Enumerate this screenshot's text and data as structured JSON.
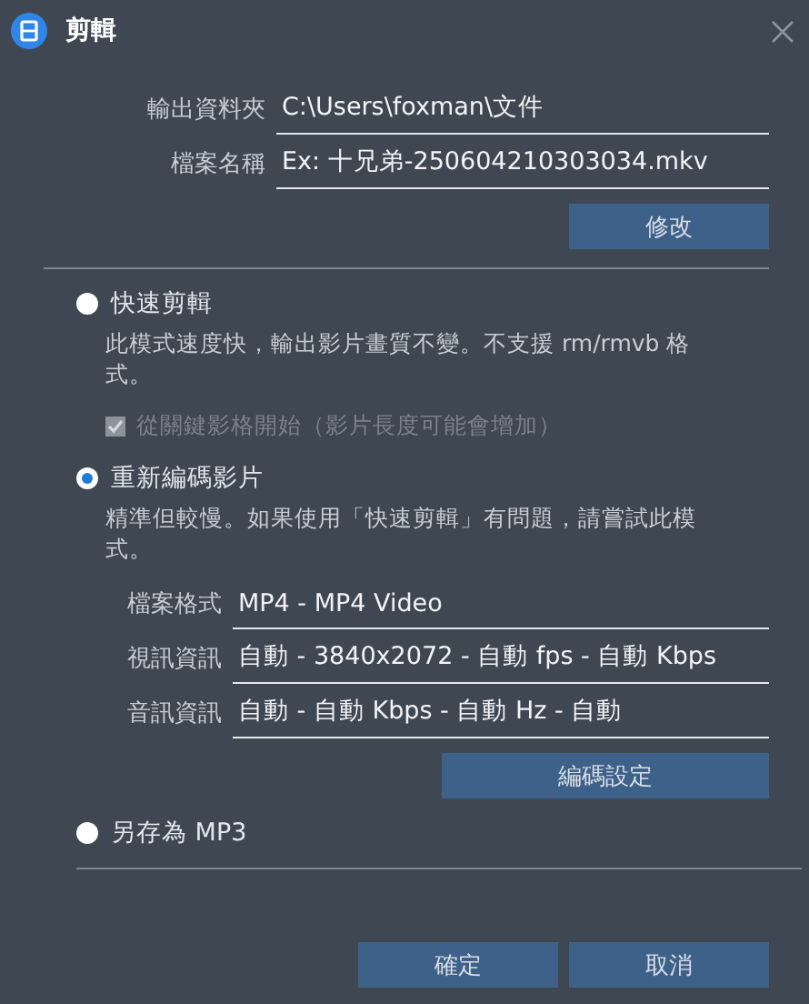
{
  "window": {
    "title": "剪輯"
  },
  "output": {
    "fields": [
      {
        "label": "輸出資料夾",
        "value": "C:\\Users\\foxman\\文件"
      },
      {
        "label": "檔案名稱",
        "value": "Ex: 十兄弟-250604210303034.mkv"
      }
    ],
    "button": "修改"
  },
  "modes": [
    {
      "label": "快速剪輯",
      "selected": false,
      "description": "此模式速度快，輸出影片畫質不變。不支援 rm/rmvb 格式。",
      "option": {
        "label": "從關鍵影格開始（影片長度可能會增加）",
        "checked": true,
        "disabled": true
      }
    },
    {
      "label": "重新編碼影片",
      "selected": true,
      "description": "精準但較慢。如果使用「快速剪輯」有問題，請嘗試此模式。",
      "fields": [
        {
          "label": "檔案格式",
          "value": "MP4 - MP4 Video"
        },
        {
          "label": "視訊資訊",
          "value": "自動 - 3840x2072 - 自動 fps - 自動 Kbps"
        },
        {
          "label": "音訊資訊",
          "value": "自動 - 自動 Kbps - 自動 Hz - 自動"
        }
      ],
      "button": "編碼設定"
    },
    {
      "label": "另存為 MP3",
      "selected": false
    }
  ],
  "buttons": [
    "確定",
    "取消"
  ]
}
